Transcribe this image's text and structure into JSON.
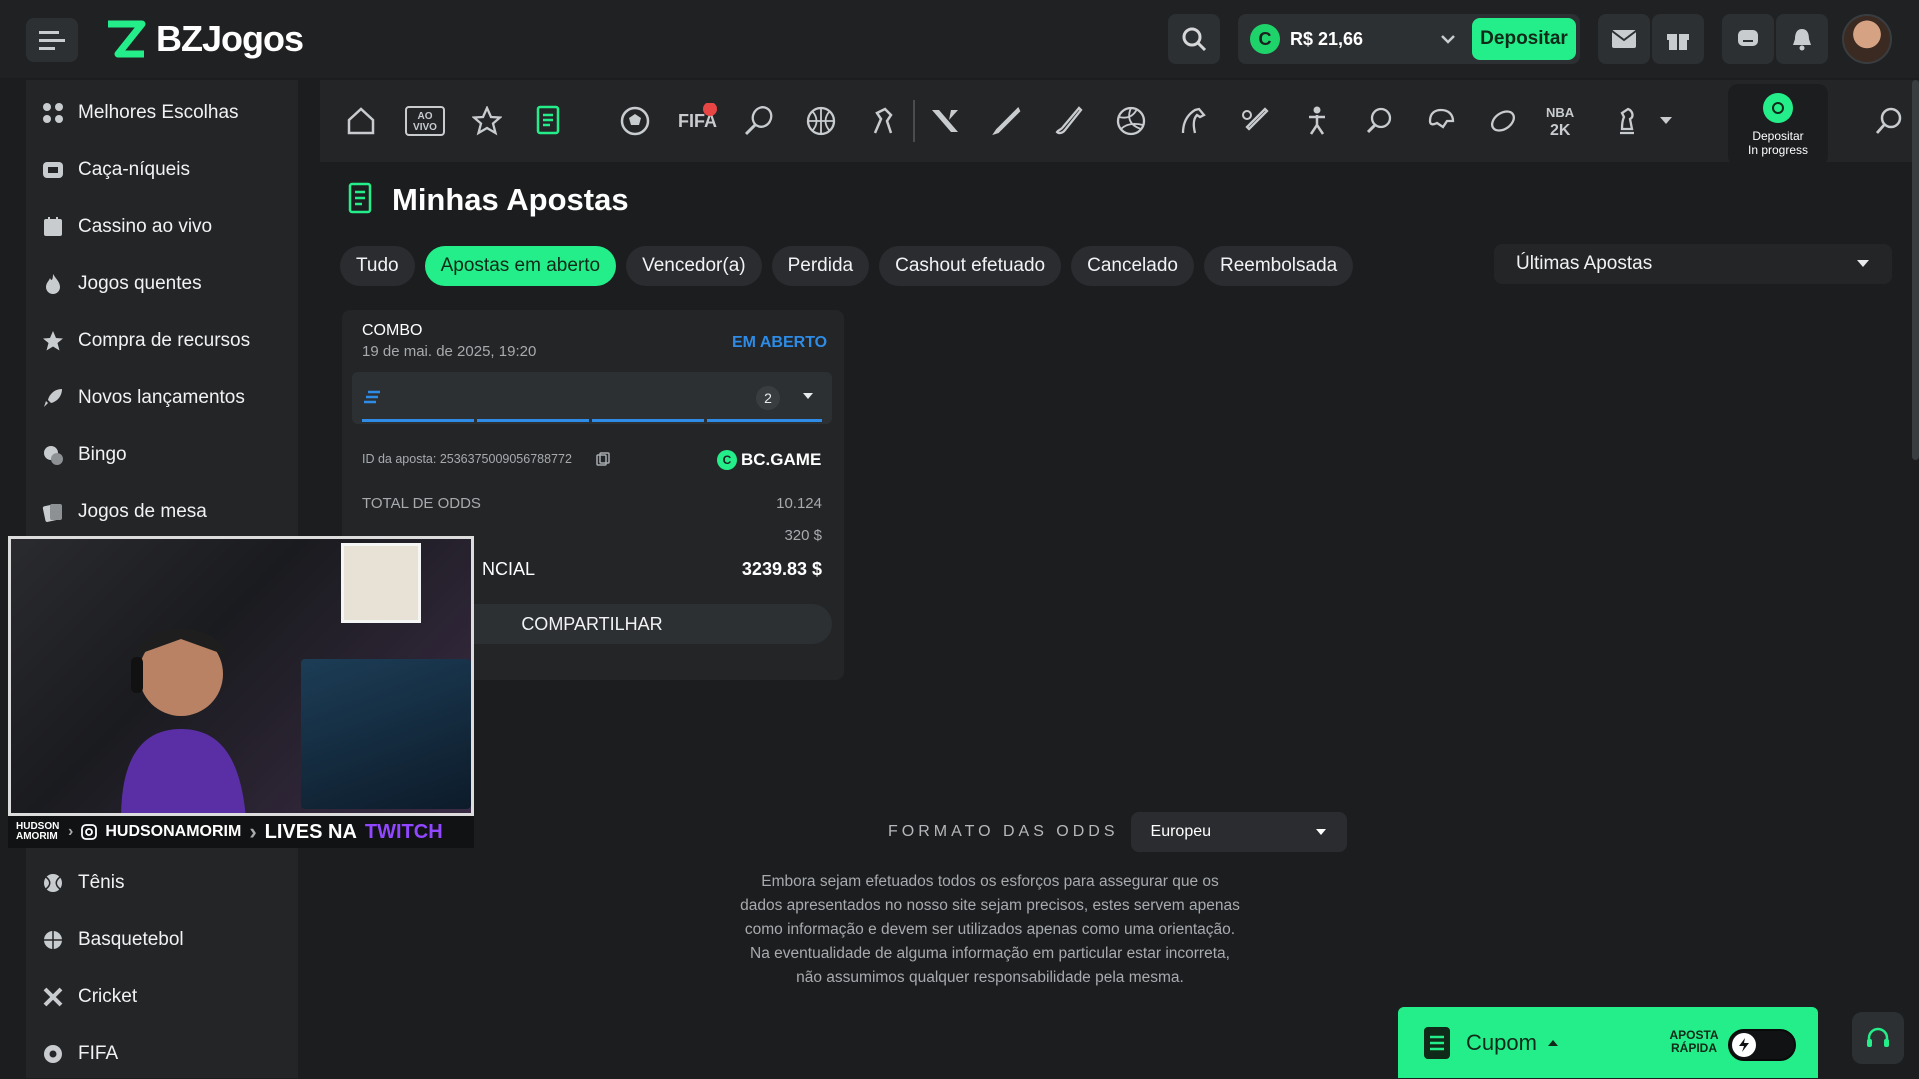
{
  "header": {
    "brand": "BZJogos",
    "balance": "R$ 21,66",
    "deposit_label": "Depositar"
  },
  "sidebar": {
    "items": [
      {
        "label": "Melhores Escolhas",
        "icon": "grid-icon"
      },
      {
        "label": "Caça-níqueis",
        "icon": "slot-icon"
      },
      {
        "label": "Cassino ao vivo",
        "icon": "live-casino-icon"
      },
      {
        "label": "Jogos quentes",
        "icon": "fire-icon"
      },
      {
        "label": "Compra de recursos",
        "icon": "star-icon"
      },
      {
        "label": "Novos lançamentos",
        "icon": "rocket-icon"
      },
      {
        "label": "Bingo",
        "icon": "bingo-icon"
      },
      {
        "label": "Jogos de mesa",
        "icon": "table-games-icon"
      },
      {
        "label": "Tênis",
        "icon": "tennis-icon"
      },
      {
        "label": "Basquetebol",
        "icon": "basketball-icon"
      },
      {
        "label": "Cricket",
        "icon": "cricket-icon"
      },
      {
        "label": "FIFA",
        "icon": "fifa-icon"
      }
    ]
  },
  "sportsbar": {
    "live_label": "AO\nVIVO",
    "fifa_label": "FIFA",
    "nba_label": "NBA",
    "deposit_progress_line1": "Depositar",
    "deposit_progress_line2": "In progress"
  },
  "page": {
    "title": "Minhas Apostas",
    "tabs": [
      "Tudo",
      "Apostas em aberto",
      "Vencedor(a)",
      "Perdida",
      "Cashout efetuado",
      "Cancelado",
      "Reembolsada"
    ],
    "active_tab": "Apostas em aberto",
    "filter": "Últimas Apostas"
  },
  "bet": {
    "type": "COMBO",
    "date": "19 de mai. de 2025, 19:20",
    "status": "EM ABERTO",
    "selections_count": "2",
    "id_label": "ID da aposta: 253637500905678877​2",
    "provider": "BC.GAME",
    "total_odds_label": "TOTAL DE ODDS",
    "total_odds": "10.124",
    "stake": "320 $",
    "potential_label": "NCIAL",
    "potential": "3239.83 $",
    "share_label": "COMPARTILHAR"
  },
  "stream_overlay": {
    "name_small": "HUDSON AMORIM",
    "handle": "HUDSONAMORIM",
    "lives": "LIVES NA",
    "twitch": "TWITCH"
  },
  "odds_format": {
    "label": "FORMATO DAS ODDS",
    "value": "Europeu"
  },
  "disclaimer": "Embora sejam efetuados todos os esforços para assegurar que os dados apresentados no nosso site sejam precisos, estes servem apenas como informação e devem ser utilizados apenas como uma orientação. Na eventualidade de alguma informação em particular estar incorreta, não assumimos qualquer responsabilidade pela mesma.",
  "betslip": {
    "label": "Cupom",
    "quick_bet": "APOSTA RÁPIDA"
  },
  "colors": {
    "accent": "#24ee89",
    "link": "#2e8ce6"
  }
}
